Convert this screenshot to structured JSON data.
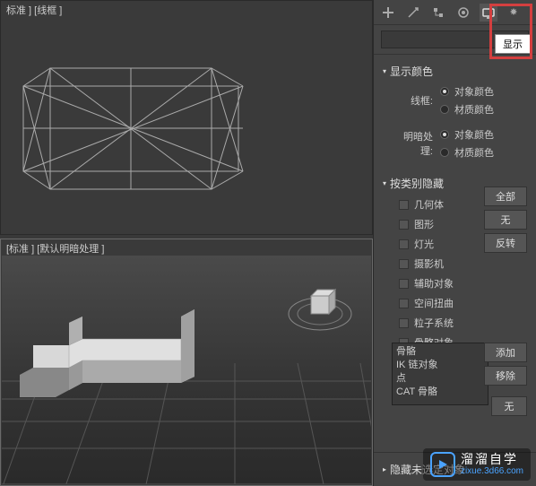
{
  "viewport_top_label": "标准 ] [线框 ]",
  "viewport_bottom_label": "[标准 ]  [默认明暗处理 ]",
  "tooltip": "显示",
  "sections": {
    "display_color": {
      "title": "显示颜色",
      "wireframe_label": "线框:",
      "shading_label": "明暗处理:",
      "option_object_color": "对象颜色",
      "option_material_color": "材质颜色"
    },
    "hide_by_category": {
      "title": "按类别隐藏",
      "items": [
        "几何体",
        "图形",
        "灯光",
        "摄影机",
        "辅助对象",
        "空间扭曲",
        "粒子系统",
        "骨骼对象"
      ],
      "btn_all": "全部",
      "btn_none": "无",
      "btn_invert": "反转",
      "btn_add": "添加",
      "btn_remove": "移除",
      "btn_none2": "无",
      "listbox": [
        "骨骼",
        "IK 链对象",
        "点",
        "CAT 骨骼"
      ]
    },
    "hide_unselected": {
      "title": "隐藏未选定对象"
    }
  },
  "watermark": {
    "title": "溜溜自学",
    "url": "zixue.3d66.com"
  }
}
